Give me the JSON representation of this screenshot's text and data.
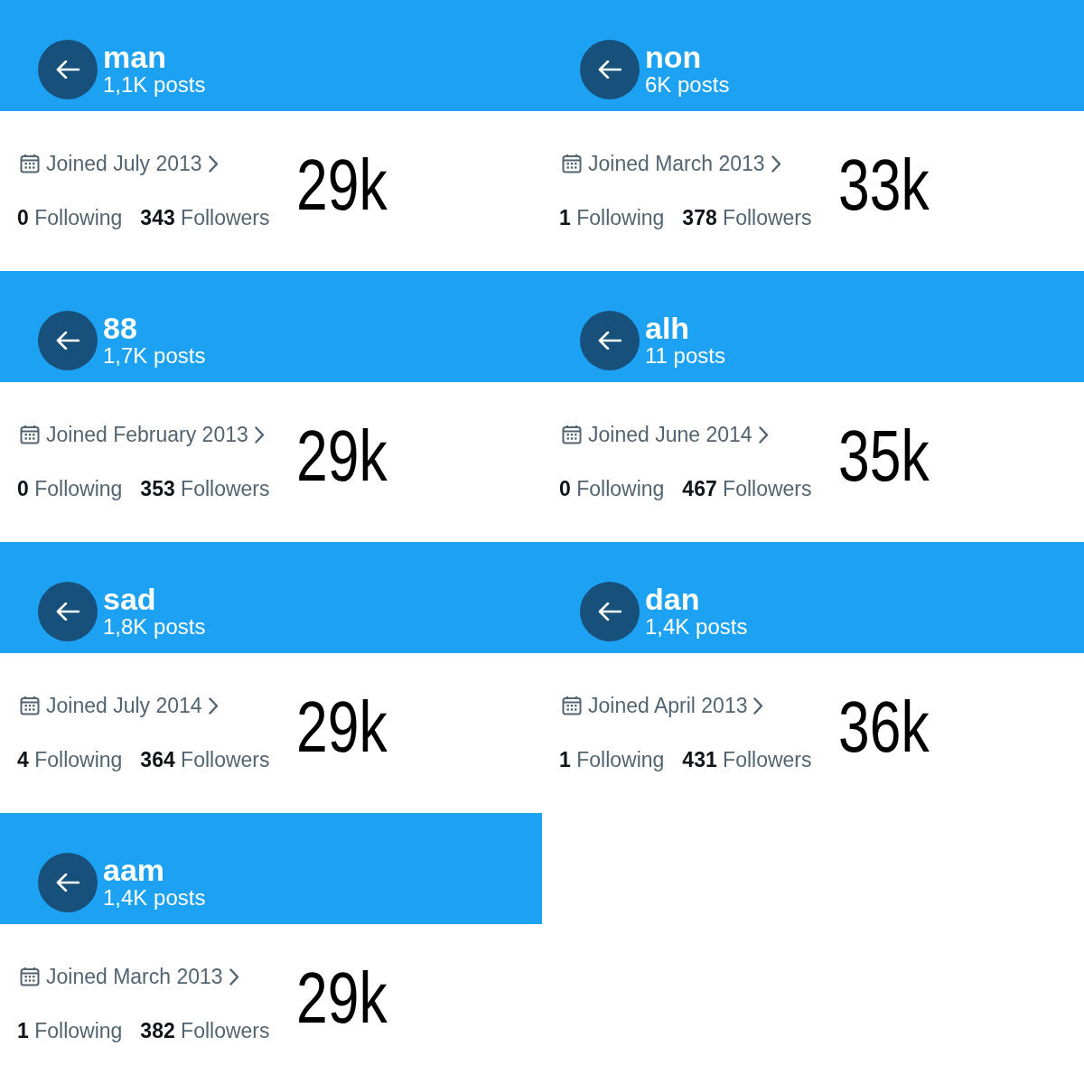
{
  "profiles": [
    {
      "name": "man",
      "posts": "1,1K posts",
      "joined": "Joined July 2013",
      "following": {
        "count": "0",
        "label": "Following"
      },
      "followers": {
        "count": "343",
        "label": "Followers"
      },
      "annotation": "29k"
    },
    {
      "name": "non",
      "posts": "6K posts",
      "joined": "Joined March 2013",
      "following": {
        "count": "1",
        "label": "Following"
      },
      "followers": {
        "count": "378",
        "label": "Followers"
      },
      "annotation": "33k"
    },
    {
      "name": "88",
      "posts": "1,7K posts",
      "joined": "Joined February 2013",
      "following": {
        "count": "0",
        "label": "Following"
      },
      "followers": {
        "count": "353",
        "label": "Followers"
      },
      "annotation": "29k"
    },
    {
      "name": "alh",
      "posts": "11 posts",
      "joined": "Joined June 2014",
      "following": {
        "count": "0",
        "label": "Following"
      },
      "followers": {
        "count": "467",
        "label": "Followers"
      },
      "annotation": "35k"
    },
    {
      "name": "sad",
      "posts": "1,8K posts",
      "joined": "Joined July 2014",
      "following": {
        "count": "4",
        "label": "Following"
      },
      "followers": {
        "count": "364",
        "label": "Followers"
      },
      "annotation": "29k"
    },
    {
      "name": "dan",
      "posts": "1,4K posts",
      "joined": "Joined April 2013",
      "following": {
        "count": "1",
        "label": "Following"
      },
      "followers": {
        "count": "431",
        "label": "Followers"
      },
      "annotation": "36k"
    },
    {
      "name": "aam",
      "posts": "1,4K posts",
      "joined": "Joined March 2013",
      "following": {
        "count": "1",
        "label": "Following"
      },
      "followers": {
        "count": "382",
        "label": "Followers"
      },
      "annotation": "29k"
    }
  ]
}
